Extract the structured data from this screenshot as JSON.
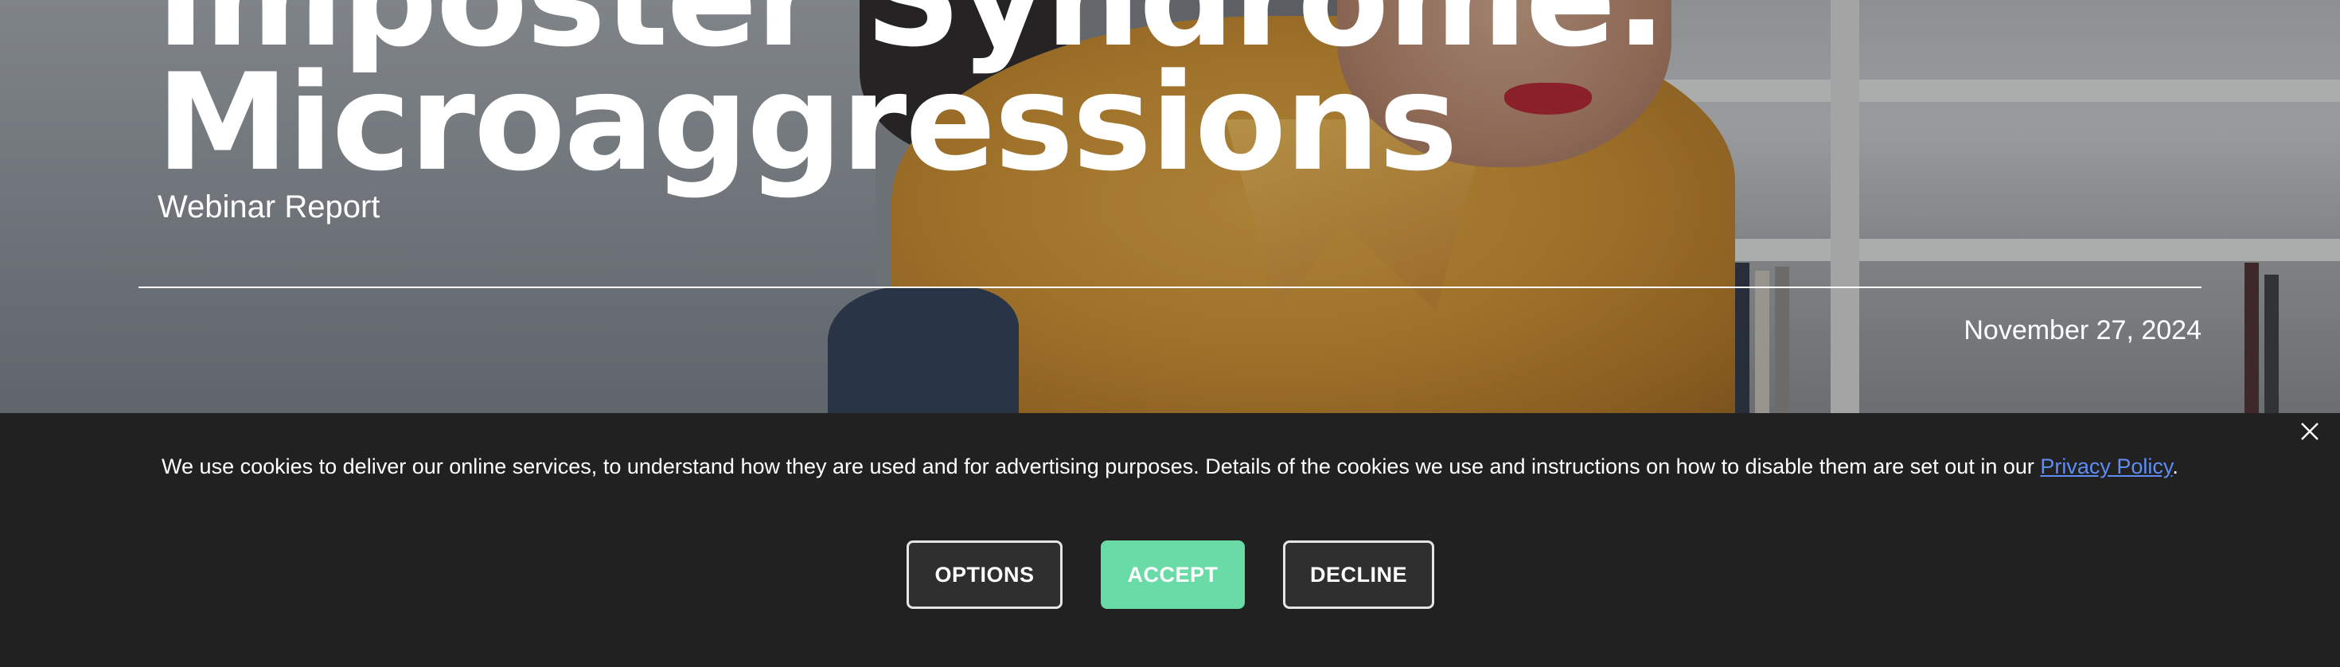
{
  "hero": {
    "title_line1": "Imposter Syndrome:",
    "title_line2": "Microaggressions",
    "subtitle": "Webinar Report",
    "date": "November 27, 2024"
  },
  "cookie_banner": {
    "message": "We use cookies to deliver our online services, to understand how they are used and for advertising purposes. Details of the cookies we use and instructions on how to disable them are set out in our ",
    "privacy_link": "Privacy Policy",
    "message_end": ".",
    "buttons": {
      "options": "OPTIONS",
      "accept": "ACCEPT",
      "decline": "DECLINE"
    },
    "close_icon": "close-icon"
  },
  "colors": {
    "banner_bg": "#212121",
    "accept_bg": "#68dba7",
    "link": "#5d8df5"
  }
}
